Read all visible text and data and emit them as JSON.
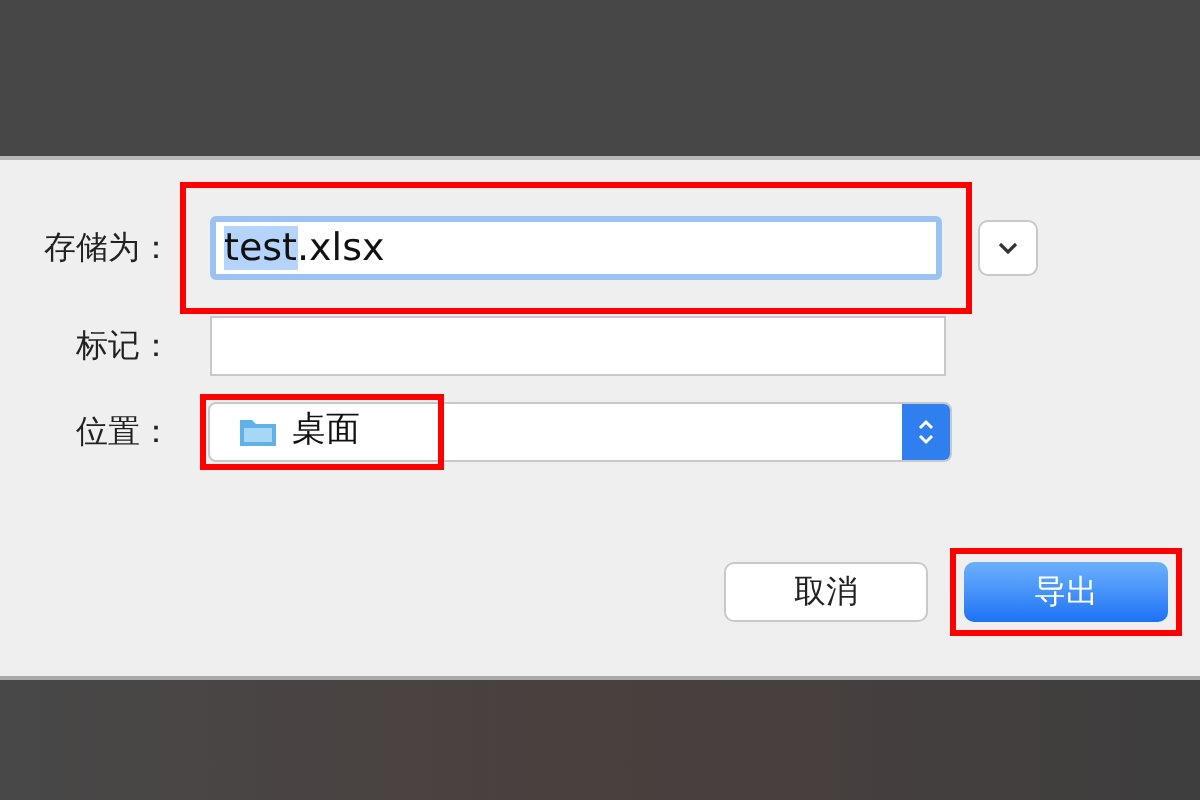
{
  "save_dialog": {
    "rows": [
      {
        "kind": "filename",
        "label": "存储为：",
        "selected_text": "test",
        "rest_text": ".xlsx",
        "annotated": true
      },
      {
        "kind": "tags",
        "label": "标记：",
        "annotated": false
      },
      {
        "kind": "location",
        "label": "位置：",
        "value": "桌面",
        "annotated": true
      }
    ],
    "buttons": [
      {
        "label": "取消",
        "default": false,
        "annotated": false
      },
      {
        "label": "导出",
        "default": true,
        "annotated": true
      }
    ]
  }
}
